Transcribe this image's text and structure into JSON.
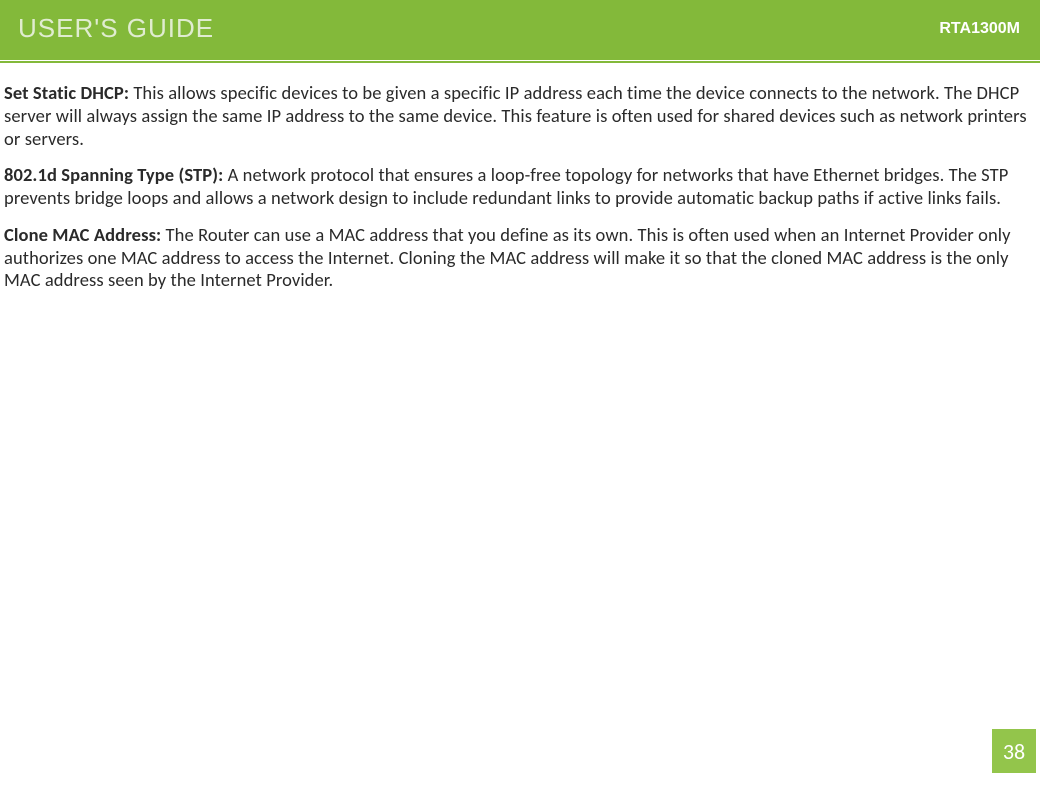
{
  "header": {
    "title": "USER'S GUIDE",
    "model": "RTA1300M"
  },
  "paragraphs": [
    {
      "term": "Set Static DHCP: ",
      "text": "This allows specific devices to be given a specific IP address each time the device connects to the network. The DHCP server will always assign the same IP address to the same device. This feature is often used for shared devices such as network printers or servers."
    },
    {
      "term": "802.1d Spanning Type (STP): ",
      "text": "A network protocol that ensures a loop-free topology for networks that have Ethernet bridges. The STP prevents bridge loops and allows a network design to include redundant links to provide automatic backup paths if active links fails."
    },
    {
      "term": "Clone MAC Address: ",
      "text": "The Router can use a MAC address that you define as its own. This is often used when an Internet Provider only authorizes one MAC address to access the Internet. Cloning the MAC address will make it so that the cloned MAC address is the only MAC address seen by the Internet Provider."
    }
  ],
  "page_number": "38"
}
